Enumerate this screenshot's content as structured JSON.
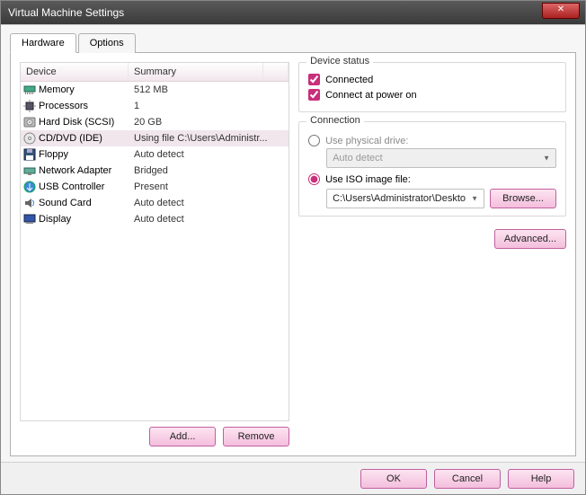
{
  "window": {
    "title": "Virtual Machine Settings"
  },
  "tabs": {
    "hardware": "Hardware",
    "options": "Options"
  },
  "table": {
    "col_device": "Device",
    "col_summary": "Summary"
  },
  "devices": [
    {
      "name": "Memory",
      "summary": "512 MB",
      "icon": "memory"
    },
    {
      "name": "Processors",
      "summary": "1",
      "icon": "cpu"
    },
    {
      "name": "Hard Disk (SCSI)",
      "summary": "20 GB",
      "icon": "hdd"
    },
    {
      "name": "CD/DVD (IDE)",
      "summary": "Using file C:\\Users\\Administr...",
      "icon": "cd",
      "selected": true
    },
    {
      "name": "Floppy",
      "summary": "Auto detect",
      "icon": "floppy"
    },
    {
      "name": "Network Adapter",
      "summary": "Bridged",
      "icon": "net"
    },
    {
      "name": "USB Controller",
      "summary": "Present",
      "icon": "usb"
    },
    {
      "name": "Sound Card",
      "summary": "Auto detect",
      "icon": "sound"
    },
    {
      "name": "Display",
      "summary": "Auto detect",
      "icon": "display"
    }
  ],
  "buttons": {
    "add": "Add...",
    "remove": "Remove",
    "browse": "Browse...",
    "advanced": "Advanced...",
    "ok": "OK",
    "cancel": "Cancel",
    "help": "Help"
  },
  "status": {
    "legend": "Device status",
    "connected": "Connected",
    "connect_power": "Connect at power on"
  },
  "connection": {
    "legend": "Connection",
    "physical": "Use physical drive:",
    "physical_value": "Auto detect",
    "iso": "Use ISO image file:",
    "iso_value": "C:\\Users\\Administrator\\Deskto"
  }
}
